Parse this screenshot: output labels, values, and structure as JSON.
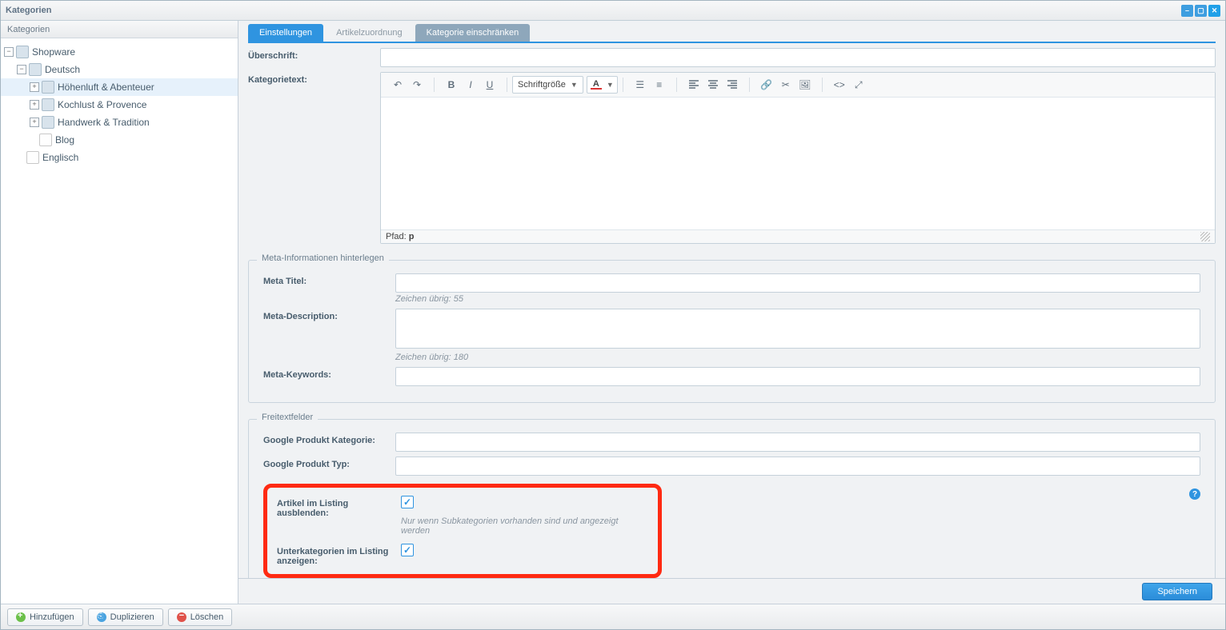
{
  "window_title": "Kategorien",
  "sidebar": {
    "header": "Kategorien",
    "nodes": {
      "shopware": "Shopware",
      "deutsch": "Deutsch",
      "hoehenluft": "Höhenluft & Abenteuer",
      "kochlust": "Kochlust & Provence",
      "handwerk": "Handwerk & Tradition",
      "blog": "Blog",
      "englisch": "Englisch"
    }
  },
  "tabs": {
    "settings": "Einstellungen",
    "assignment": "Artikelzuordnung",
    "restrict": "Kategorie einschränken"
  },
  "form": {
    "ueberschrift_label": "Überschrift:",
    "kategorietext_label": "Kategorietext:",
    "rte": {
      "fontsize_label": "Schriftgröße",
      "path_label": "Pfad:",
      "path_value": "p"
    },
    "meta_legend": "Meta-Informationen hinterlegen",
    "meta_title_label": "Meta Titel:",
    "meta_title_hint": "Zeichen übrig: 55",
    "meta_desc_label": "Meta-Description:",
    "meta_desc_hint": "Zeichen übrig: 180",
    "meta_keywords_label": "Meta-Keywords:",
    "free_legend": "Freitextfelder",
    "google_cat_label": "Google Produkt Kategorie:",
    "google_type_label": "Google Produkt Typ:",
    "hide_articles_label": "Artikel im Listing ausblenden:",
    "hide_articles_hint": "Nur wenn Subkategorien vorhanden sind und angezeigt werden",
    "show_subcats_label": "Unterkategorien im Listing anzeigen:"
  },
  "footer": {
    "add": "Hinzufügen",
    "duplicate": "Duplizieren",
    "delete": "Löschen",
    "save": "Speichern"
  }
}
